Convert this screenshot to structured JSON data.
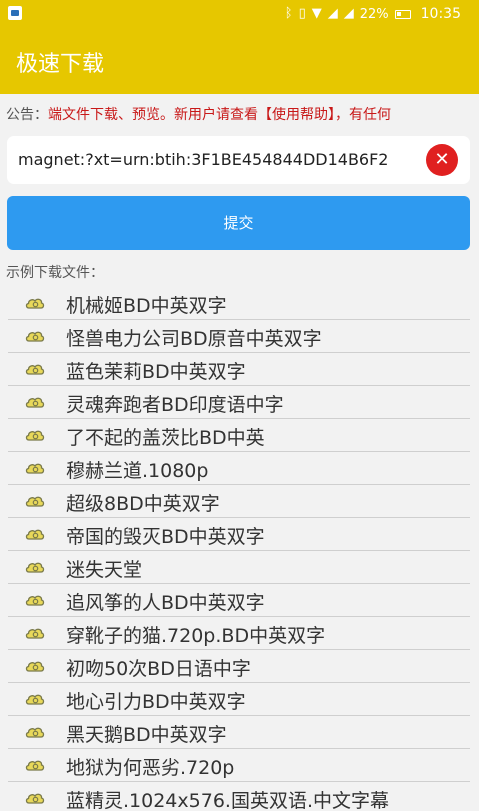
{
  "status_bar": {
    "battery": "22%",
    "time": "10:35"
  },
  "app_bar": {
    "title": "极速下载"
  },
  "notice": {
    "label": "公告：",
    "text": "端文件下载、预览。新用户请查看【使用帮助】，有任何"
  },
  "magnet_input": {
    "value": "magnet:?xt=urn:btih:3F1BE454844DD14B6F2"
  },
  "submit": {
    "label": "提交"
  },
  "examples": {
    "label": "示例下载文件：",
    "items": [
      "机械姬BD中英双字",
      "怪兽电力公司BD原音中英双字",
      "蓝色茉莉BD中英双字",
      "灵魂奔跑者BD印度语中字",
      "了不起的盖茨比BD中英",
      "穆赫兰道.1080p",
      "超级8BD中英双字",
      "帝国的毁灭BD中英双字",
      "迷失天堂",
      "追风筝的人BD中英双字",
      "穿靴子的猫.720p.BD中英双字",
      "初吻50次BD日语中字",
      "地心引力BD中英双字",
      "黑天鹅BD中英双字",
      "地狱为何恶劣.720p",
      "蓝精灵.1024x576.国英双语.中文字幕"
    ]
  },
  "colors": {
    "app_bar": "#e6c700",
    "submit": "#2e9af0",
    "notice_text": "#c81818",
    "clear_button": "#e02020"
  }
}
